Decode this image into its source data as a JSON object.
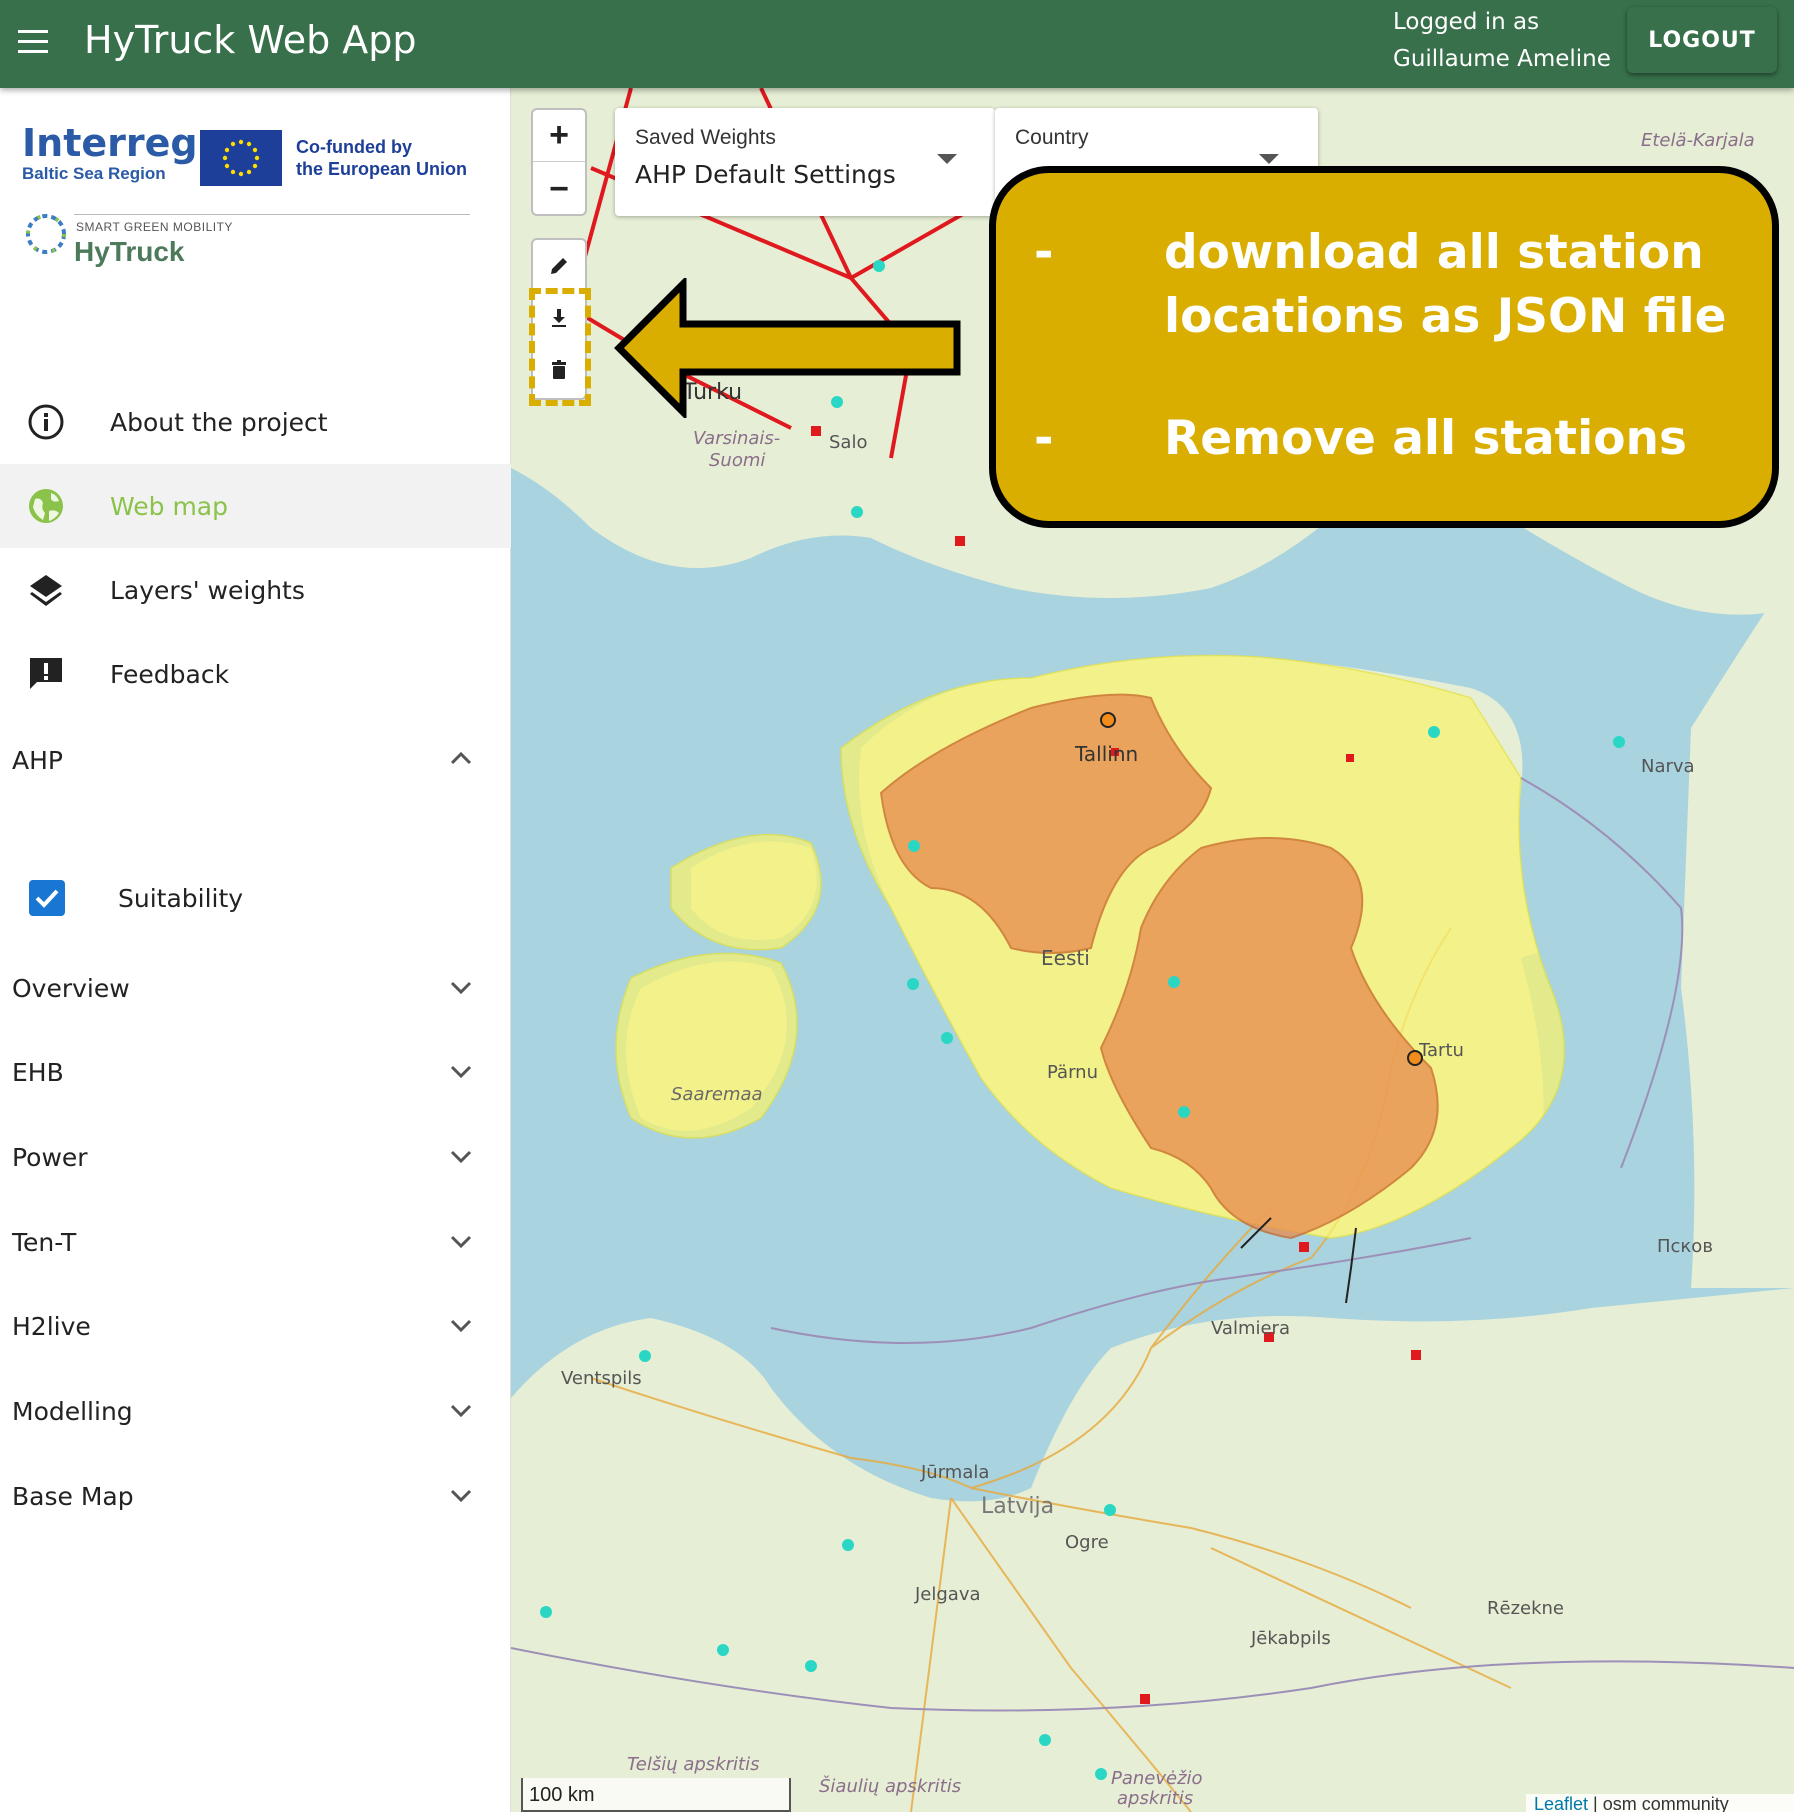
{
  "appbar": {
    "title": "HyTruck Web App",
    "login_line1": "Logged in as",
    "login_line2": "Guillaume Ameline",
    "logout": "LOGOUT"
  },
  "logos": {
    "interreg": "Interreg",
    "region": "Baltic Sea Region",
    "cofunded1": "Co-funded by",
    "cofunded2": "the European Union",
    "sgm": "SMART GREEN MOBILITY",
    "hytruck": "HyTruck"
  },
  "nav": {
    "about": "About the project",
    "webmap": "Web map",
    "layers": "Layers' weights",
    "feedback": "Feedback"
  },
  "sections": {
    "ahp": "AHP",
    "suitability": "Suitability",
    "overview": "Overview",
    "ehb": "EHB",
    "power": "Power",
    "tent": "Ten-T",
    "h2live": "H2live",
    "modelling": "Modelling",
    "basemap": "Base Map"
  },
  "map": {
    "saved_weights_label": "Saved Weights",
    "saved_weights_value": "AHP Default Settings",
    "country_label": "Country",
    "callout_dash": "-",
    "callout_item1": "download  all station locations as JSON file",
    "callout_item2": "Remove all stations",
    "scale": "100 km",
    "attrib_leaflet": "Leaflet",
    "attrib_rest": " | osm community",
    "places": {
      "turku": "Turku",
      "salo": "Salo",
      "varsinais": "Varsinais-",
      "suomi": "Suomi",
      "etela": "Etelä-Karjala",
      "tallinn": "Tallinn",
      "narva": "Narva",
      "eesti": "Eesti",
      "parnu": "Pärnu",
      "tartu": "Tartu",
      "saaremaa": "Saaremaa",
      "pskov": "Псков",
      "valmiera": "Valmiera",
      "ventspils": "Ventspils",
      "jurmala": "Jūrmala",
      "latvija": "Latvija",
      "ogre": "Ogre",
      "jelgava": "Jelgava",
      "rezekne": "Rēzekne",
      "jekabpils": "Jēkabpils",
      "telsiu": "Telšių apskritis",
      "siauliu": "Šiaulių apskritis",
      "panevezio": "Panevėžio",
      "apskritis": "apskritis"
    }
  },
  "colors": {
    "appbar": "#37704a",
    "active_nav": "#8bc34a",
    "checkbox": "#1976d2",
    "callout": "#d9ae00",
    "water": "#a9d3de",
    "land": "#e8efd9"
  }
}
